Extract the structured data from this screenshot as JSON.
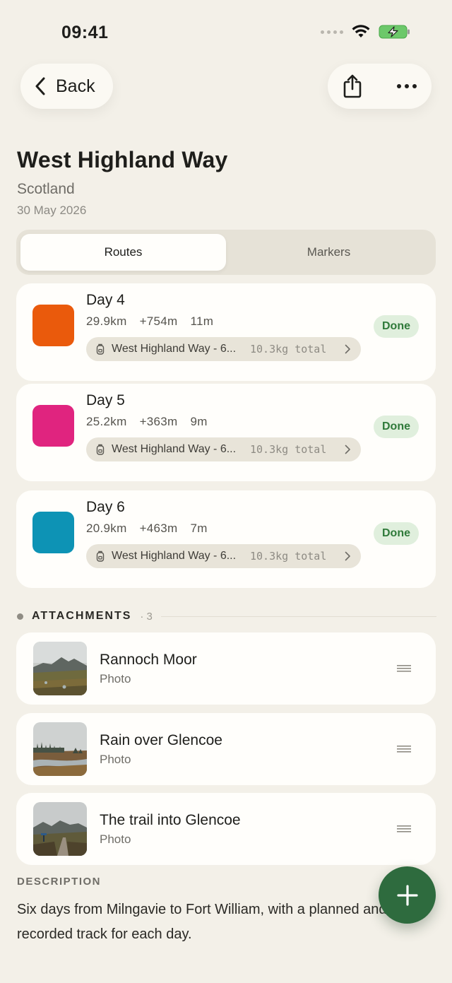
{
  "status_bar": {
    "time": "09:41",
    "icons": [
      "signal-dots-icon",
      "wifi-icon",
      "battery-charging-icon"
    ]
  },
  "nav": {
    "back_label": "Back",
    "share_icon": "share-icon",
    "more_icon": "more-icon"
  },
  "header": {
    "title": "West Highland Way",
    "subtitle": "Scotland",
    "date": "30 May 2026"
  },
  "tabs": [
    {
      "label": "Routes",
      "active": true
    },
    {
      "label": "Markers",
      "active": false
    }
  ],
  "routes": [
    {
      "name": "Day 4",
      "distance": "29.9km",
      "elevation": "+754m",
      "duration": "11m",
      "pack_name": "West Highland Way - 6...",
      "pack_weight": "10.3kg total",
      "status": "Done",
      "color": "#ea5a0c"
    },
    {
      "name": "Day 5",
      "distance": "25.2km",
      "elevation": "+363m",
      "duration": "9m",
      "pack_name": "West Highland Way - 6...",
      "pack_weight": "10.3kg total",
      "status": "Done",
      "color": "#e0247f"
    },
    {
      "name": "Day 6",
      "distance": "20.9km",
      "elevation": "+463m",
      "duration": "7m",
      "pack_name": "West Highland Way - 6...",
      "pack_weight": "10.3kg total",
      "status": "Done",
      "color": "#0d93b5"
    }
  ],
  "attachments": {
    "title": "ATTACHMENTS",
    "count": "· 3",
    "items": [
      {
        "title": "Rannoch Moor",
        "type": "Photo"
      },
      {
        "title": "Rain over Glencoe",
        "type": "Photo"
      },
      {
        "title": "The trail into Glencoe",
        "type": "Photo"
      }
    ]
  },
  "description": {
    "label": "DESCRIPTION",
    "text": "Six days from Milngavie to Fort William, with a planned and recorded track for each day."
  },
  "colors": {
    "background": "#f3f0e8",
    "card": "#fffefb",
    "accent_green": "#2e6b3e",
    "done_bg": "#e0efdd",
    "done_text": "#2f7a3a"
  },
  "fab": {
    "icon": "plus-icon"
  }
}
